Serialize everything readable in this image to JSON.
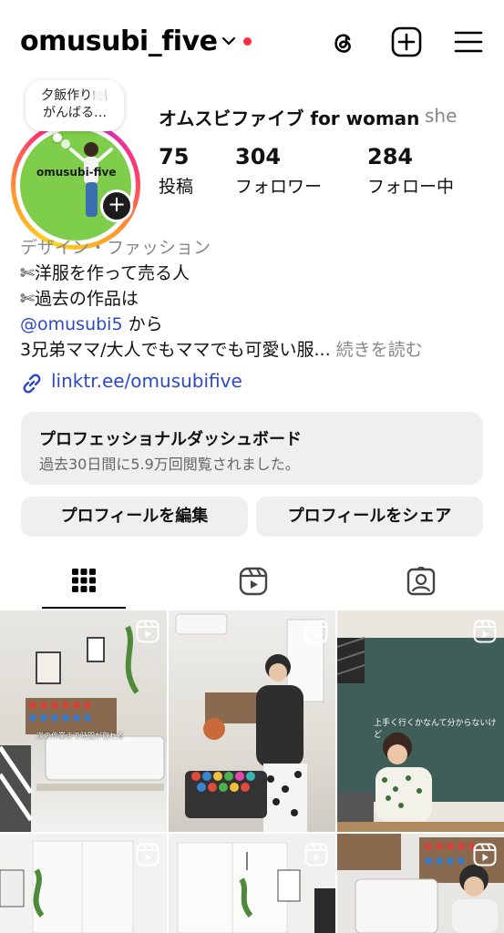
{
  "header": {
    "username": "omusubi_five",
    "icons": [
      "chevron-down-icon",
      "threads-icon",
      "new-post-icon",
      "menu-icon"
    ],
    "notification_color": "#ff2d3d"
  },
  "note": {
    "line1": "夕飯作り🍽️",
    "line2": "がんばる…"
  },
  "avatar": {
    "label": "omusubi-five"
  },
  "profile": {
    "display_name": "オムスビファイブ for woman",
    "pronoun": "she"
  },
  "stats": [
    {
      "value": "75",
      "label": "投稿"
    },
    {
      "value": "304",
      "label": "フォロワー"
    },
    {
      "value": "284",
      "label": "フォロー中"
    }
  ],
  "bio": {
    "category": "デザイン・ファッション",
    "line1": "✄洋服を作って売る人",
    "line2": "✄過去の作品は",
    "mention": "@omusubi5",
    "mention_suffix": " から",
    "line4": "3兄弟ママ/大人でもママでも可愛い服...",
    "more": " 続きを読む",
    "link": "linktr.ee/omusubifive"
  },
  "dashboard": {
    "title": "プロフェッショナルダッシュボード",
    "subtitle": "過去30日間に5.9万回閲覧されました。"
  },
  "buttons": {
    "edit": "プロフィールを編集",
    "share": "プロフィールをシェア"
  },
  "tabs": [
    "grid-icon",
    "reels-icon",
    "tagged-icon"
  ],
  "grid": {
    "tiles": [
      {
        "caption": "次の作業まで時間が取れる"
      },
      {
        "caption": ""
      },
      {
        "caption": "上手く行くかなんて分からないけど"
      },
      {
        "caption": ""
      },
      {
        "caption": ""
      },
      {
        "caption": ""
      }
    ]
  },
  "colors": {
    "link": "#2c49c9",
    "secondary_bg": "#efefef"
  }
}
